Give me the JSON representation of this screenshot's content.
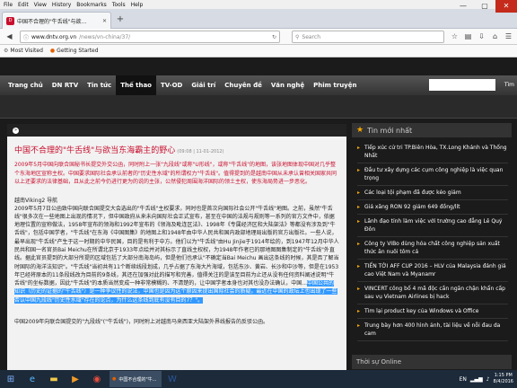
{
  "browser": {
    "menu": [
      "File",
      "Edit",
      "View",
      "History",
      "Bookmarks",
      "Tools",
      "Help"
    ],
    "tab_title": "中国不合理的\"牛舌线\"与欲…",
    "url_host": "www.dntv.org.vn",
    "url_path": "/news/vn-china/37/",
    "search_placeholder": "Search",
    "bookmarks": [
      "Most Visited",
      "Getting Started"
    ]
  },
  "site": {
    "nav": [
      "Trang chủ",
      "DN RTV",
      "Tin tức",
      "Thế thao",
      "TV-OD",
      "Giải trí",
      "Chuyên đề",
      "Văn nghệ",
      "Phim truyện"
    ],
    "search_button": "Tìm",
    "article": {
      "title": "中国不合理的\"牛舌线\"与欲当东海霸主的野心",
      "meta": "(09:08 | 11-01-2012)",
      "lead": "2009年5月中国向联合国秘书长提交外交公函，同时附上一张\"九段线\"或称\"U形线\"，或称\"牛舌线\"的地图，该张地图体现中国对几乎整个东海地区宣称主权。中国要求国际社会承认前者的\"历史性水域\"的所谓权力\"牛舌线\"。值得提到的是越南中国从未承认曾相关国家共同以上还要求的法律基础，且从此之前今仍进行更为的说的主张，公然侵犯周围海洋国际的领土主权，使东海局势进一步恶化。",
      "byline": "越南Viking2 导航",
      "body_normal": "2009年5月7日公函致中国向联合国提交大会选出的\"牛舌线\"主权要求，同时也是首次向国际社会公开\"牛舌线\"地图。之前，虽然\"牛舌线\"很多次在一些地图上出现的情况下，但中国政府从来未向国际社会正式宣布，甚至在中国的法规与规则等一系列的官方文件中，依据地理位置的宣称做法，1958年宣布的领海和1992年宣布的《领海及毗连区法》、1998年《专属经济区和大陆架法》等都没有涉及到\"牛舌线\"，包括中国学者，\"牛舌线\"在东海《中国图集》的地图上和1948年由中华人民共和国内政部地理局出版的官方出版社。一些人说，最早出现\"牛舌线\"产生于这一时期的中华民国，目的是有利于中方。他们以为\"牛舌线\"由Hu Jinjie于1914年绘的，到1947年12月中华人民共和国一名官员Bai Meichu在所谓北京于1933年点绘并对其标示了直线主权权，为1948年作者已的那地图图集制定的\"牛舌线\"外直线。据此官员提到的大部分所提的区域包括了大部分南海岛屿，但是他们也承认\"不确定当Bai Meichu 画出这条线的时候，其是否了解当时国际的海洋法知识\"。\"牛舌线\"当初共有11个断续线段划成，几乎占据了东海大片海域，包括东沙、黄岩、长沙和中沙等，但是在1953年已经将原本的11条段线改为目前的9条线，其还在加强对此的描写和完善，值得关注的是该至目前为止还从没有任何资料阐述说明\"牛舌线\"的坐标数据，因此\"牛舌线\"的本质当然变成一种非常模糊的、不清楚的，让中国学者本身也对其也没办法确认，中国...",
      "body_highlight": "中国公共的知识（历史的证据的\"牛舌线\"）是一种争议性的说法，中国也是因为这个原因来提出国际社会的质疑。最近在中国的政坛上也出现了一些否认中国九段线\"历史性水域\"存在的论点，为什么这条线到底有没有目的7？\"。",
      "tail": "中国2009年向联合国提交的\"九段线\"(\"牛舌线\")，同时附上对越南马来西亚大陆架外界线报告的反驳公函。"
    },
    "sidebar": {
      "heading": "Tin mới nhất",
      "items": [
        "Tiếp xúc cử tri TP.Biên Hòa, TX.Long Khánh và Thống Nhất",
        "Đầu tư xây dựng các cụm công nghiệp là việc quan trọng",
        "Các loại tội phạm đã được kéo giảm",
        "Giá xăng RON 92 giảm 649 đồng/lít",
        "Lãnh đạo tỉnh làm việc với trường cao đẳng Lê Quý Đôn",
        "Công ty VIBo dùng hóa chất công nghiệp sản xuất thức ăn nuôi tôm cá",
        "TIẾN TỚI AFF CUP 2016 – HLV của Malaysia đánh giá cao Việt Nam và Myanamr",
        "VINCERT công bố 4 mã độc cần ngăn chặn khẩn cấp sau vụ Vietnam Airlines bị hack",
        "Tìm lại product key của Windows và Office",
        "Trung bày hơn 400 hình ảnh, tài liệu về nỗi đau da cam"
      ],
      "footer": "Thời sự Online"
    }
  },
  "taskbar": {
    "active_label": "中国不合理的\"牛...",
    "lang": "EN",
    "time": "1:15 PM",
    "date": "8/4/2016"
  }
}
